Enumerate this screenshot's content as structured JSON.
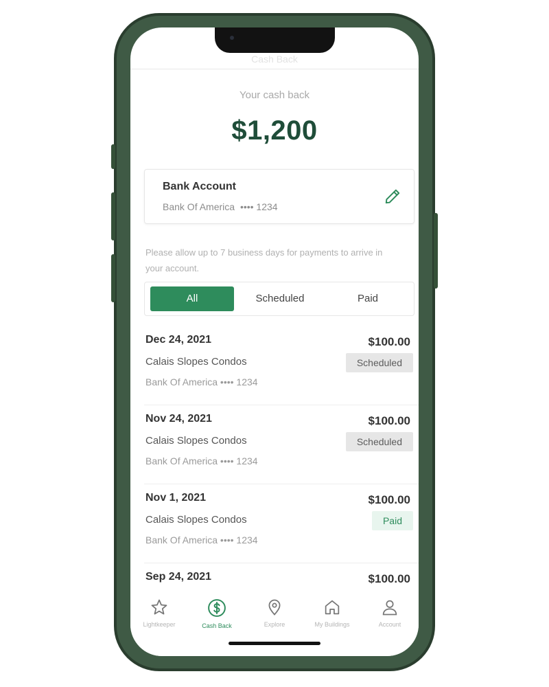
{
  "header": {
    "title": "Cash Back"
  },
  "cashback": {
    "label": "Your cash back",
    "amount": "$1,200"
  },
  "bank": {
    "title": "Bank Account",
    "name": "Bank Of America",
    "mask": "•••• 1234"
  },
  "notice": "Please allow up to 7 business days for payments to arrive in your account.",
  "tabs": [
    {
      "label": "All",
      "active": true
    },
    {
      "label": "Scheduled",
      "active": false
    },
    {
      "label": "Paid",
      "active": false
    }
  ],
  "payments": [
    {
      "date": "Dec 24, 2021",
      "amount": "$100.00",
      "place": "Calais Slopes Condos",
      "bank": "Bank Of America •••• 1234",
      "status": "Scheduled"
    },
    {
      "date": "Nov 24, 2021",
      "amount": "$100.00",
      "place": "Calais Slopes Condos",
      "bank": "Bank Of America •••• 1234",
      "status": "Scheduled"
    },
    {
      "date": "Nov 1, 2021",
      "amount": "$100.00",
      "place": "Calais Slopes Condos",
      "bank": "Bank Of America •••• 1234",
      "status": "Paid"
    },
    {
      "date": "Sep 24, 2021",
      "amount": "$100.00"
    }
  ],
  "nav": [
    {
      "label": "Lightkeeper",
      "icon": "star-icon",
      "active": false
    },
    {
      "label": "Cash Back",
      "icon": "dollar-circle-icon",
      "active": true
    },
    {
      "label": "Explore",
      "icon": "map-pin-icon",
      "active": false
    },
    {
      "label": "My Buildings",
      "icon": "home-icon",
      "active": false
    },
    {
      "label": "Account",
      "icon": "user-icon",
      "active": false
    }
  ],
  "colors": {
    "accent": "#2e8c5c",
    "amount_text": "#1f4d39",
    "phone_frame": "#3f5a45"
  }
}
